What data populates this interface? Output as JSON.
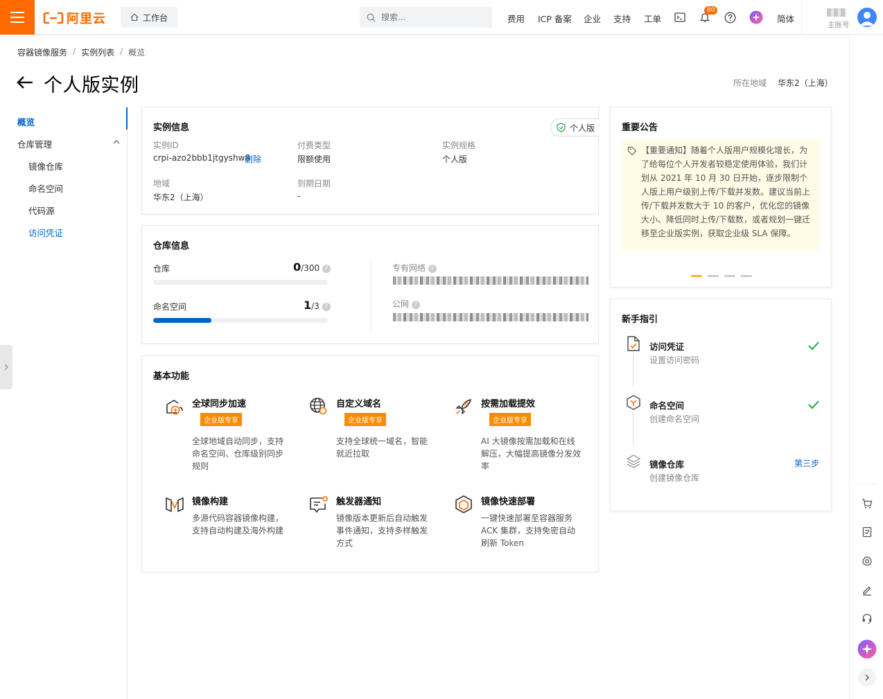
{
  "topbar": {
    "brand": "阿里云",
    "workbench": "工作台",
    "search_placeholder": "搜索...",
    "nav": [
      "费用",
      "ICP 备案",
      "企业",
      "支持",
      "工单"
    ],
    "notification_count": "80",
    "lang": "简体",
    "account_label": "主账号"
  },
  "breadcrumb": [
    "容器镜像服务",
    "实例列表",
    "概览"
  ],
  "page": {
    "title": "个人版实例",
    "region_label": "所在地域",
    "region_value": "华东2（上海）"
  },
  "sidebar": {
    "items": [
      {
        "label": "概览",
        "active": true
      },
      {
        "label": "仓库管理"
      },
      {
        "label": "镜像仓库"
      },
      {
        "label": "命名空间"
      },
      {
        "label": "代码源"
      },
      {
        "label": "访问凭证",
        "highlight": true
      }
    ]
  },
  "instance_info": {
    "title": "实例信息",
    "edition_tag": "个人版",
    "id_label": "实例ID",
    "id_value": "crpi-azo2bbb1jtgyshw8",
    "delete_link": "删除",
    "pay_type_label": "付费类型",
    "pay_type_value": "限额使用",
    "spec_label": "实例规格",
    "spec_value": "个人版",
    "region_label": "地域",
    "region_value": "华东2（上海）",
    "expire_label": "到期日期",
    "expire_value": "-"
  },
  "repo_info": {
    "title": "仓库信息",
    "repo_label": "仓库",
    "repo_used": "0",
    "repo_total": "/300",
    "repo_fraction": 0,
    "ns_label": "命名空间",
    "ns_used": "1",
    "ns_total": "/3",
    "ns_fraction": 0.333,
    "vpc_label": "专有网络",
    "public_label": "公网"
  },
  "features": {
    "title": "基本功能",
    "items": [
      {
        "icon": "global-sync-icon",
        "title": "全球同步加速",
        "tag": "企业版专享",
        "desc": "全球地域自动同步，支持命名空间、仓库级别同步规则"
      },
      {
        "icon": "domain-globe-icon",
        "title": "自定义域名",
        "tag": "企业版专享",
        "desc": "支持全球统一域名，智能就近拉取"
      },
      {
        "icon": "rocket-icon",
        "title": "按需加载提效",
        "tag": "企业版专享",
        "desc": "AI 大镜像按需加载和在线解压，大幅提高镜像分发效率"
      },
      {
        "icon": "build-icon",
        "title": "镜像构建",
        "tag": "",
        "desc": "多源代码容器镜像构建，支持自动构建及海外构建"
      },
      {
        "icon": "trigger-icon",
        "title": "触发器通知",
        "tag": "",
        "desc": "镜像版本更新后自动触发事件通知，支持多样触发方式"
      },
      {
        "icon": "deploy-icon",
        "title": "镜像快速部署",
        "tag": "",
        "desc": "一键快速部署至容器服务ACK 集群，支持免密自动刷新 Token"
      }
    ]
  },
  "notice": {
    "title": "重要公告",
    "text": "【重要通知】随着个人版用户规模化增长，为了给每位个人开发者较稳定使用体验，我们计划从 2021 年 10 月 30 日开始，逐步限制个人版上用户级别上传/下载并发数。建议当前上传/下载并发数大于 10 的客户，优化您的镜像大小、降低同时上传/下载数，或者规划一键迁移至企业版实例，获取企业级 SLA 保障。"
  },
  "guide": {
    "title": "新手指引",
    "steps": [
      {
        "title": "访问凭证",
        "sub": "设置访问密码",
        "done": true
      },
      {
        "title": "命名空间",
        "sub": "创建命名空间",
        "done": true
      },
      {
        "title": "镜像仓库",
        "sub": "创建镜像仓库",
        "done": false,
        "action": "第三步"
      }
    ]
  },
  "colors": {
    "brand_orange": "#ff6a00",
    "link_blue": "#0064c8",
    "success_green": "#1fa64a",
    "tag_orange": "#ff8a00"
  }
}
